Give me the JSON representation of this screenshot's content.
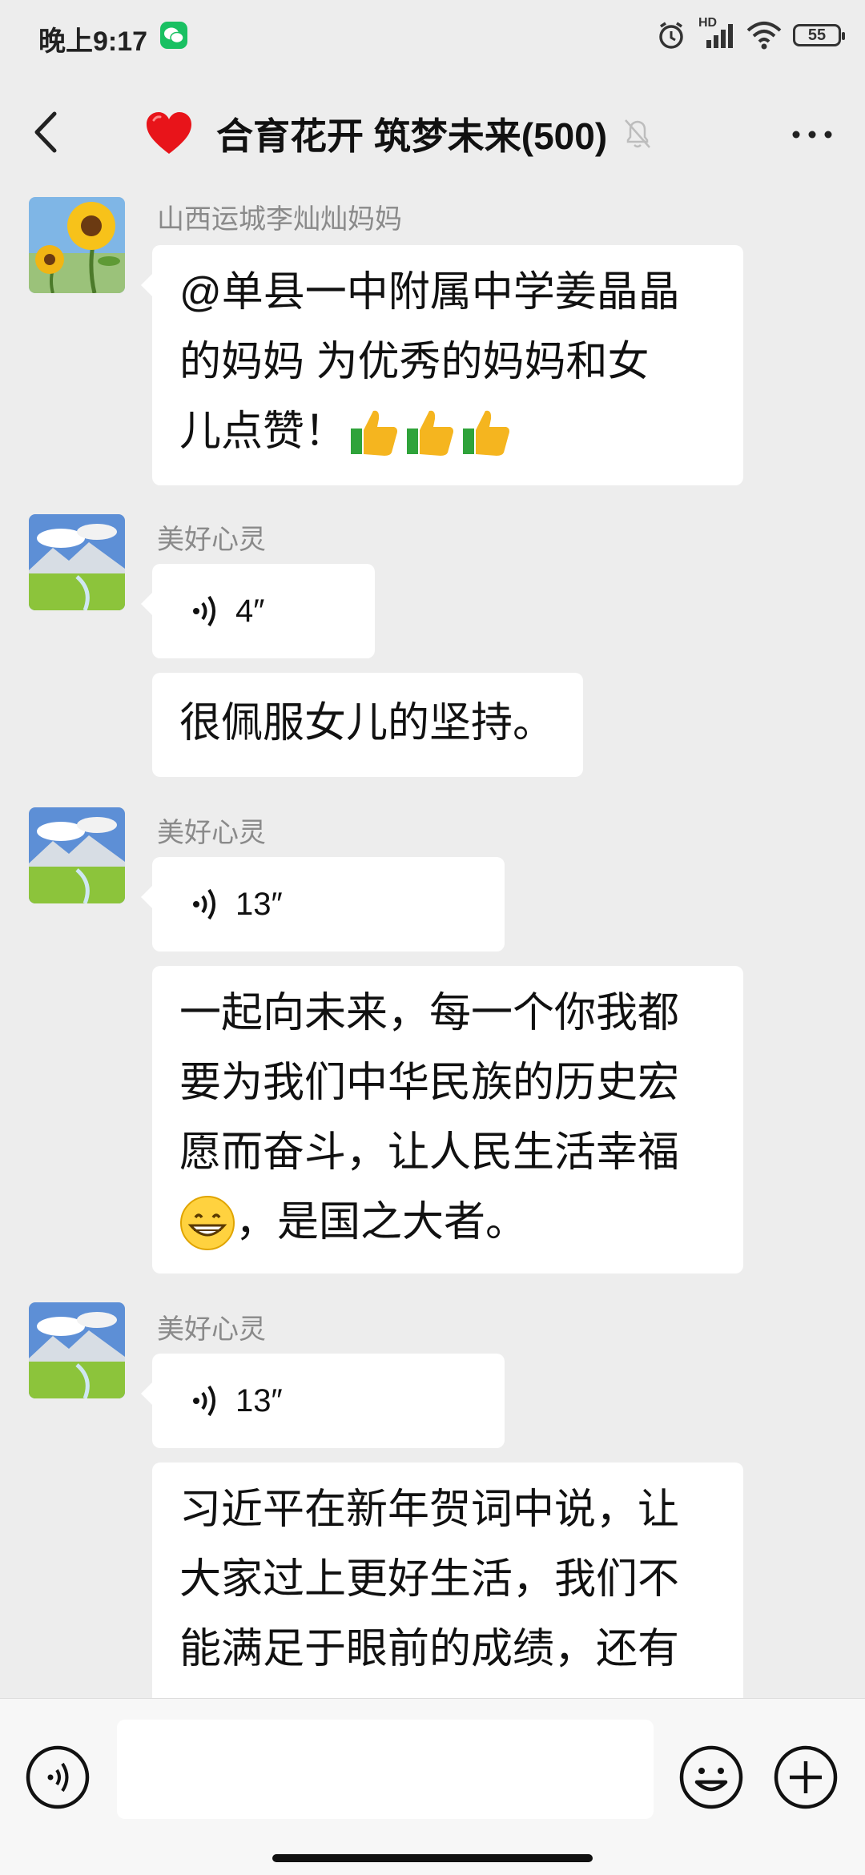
{
  "status_bar": {
    "time": "晚上9:17",
    "network": "HD",
    "battery": "55",
    "icons": [
      "wechat-icon",
      "alarm-icon",
      "signal-icon",
      "wifi-icon",
      "battery-icon"
    ]
  },
  "header": {
    "title": "合育花开 筑梦未来(500)",
    "icons": [
      "back-arrow-icon",
      "red-heart-icon",
      "mute-bell-icon",
      "more-icon"
    ]
  },
  "messages": [
    {
      "sender": "山西运城李灿灿妈妈",
      "avatar": "sunflower-avatar",
      "lines": [
        "@单县一中附属中学姜晶晶",
        "的妈妈  为优秀的妈妈和女",
        "儿点赞！"
      ],
      "emoji": "thumbs-up-icon"
    },
    {
      "sender": "美好心灵",
      "avatar": "landscape-avatar",
      "voice_duration": "4″"
    },
    {
      "text": "很佩服女儿的坚持。"
    },
    {
      "sender": "美好心灵",
      "avatar": "landscape-avatar",
      "voice_duration": "13″"
    },
    {
      "lines": [
        "一起向未来，每一个你我都",
        "要为我们中华民族的历史宏",
        "愿而奋斗，让人民生活幸福",
        "，是国之大者。"
      ],
      "emoji": "grinning-face-icon"
    },
    {
      "sender": "美好心灵",
      "avatar": "landscape-avatar",
      "voice_duration": "13″"
    },
    {
      "lines": [
        "习近平在新年贺词中说，让",
        "大家过上更好生活，我们不",
        "能满足于眼前的成绩，还有"
      ]
    }
  ],
  "input_bar": {
    "text": "",
    "icons": [
      "voice-input-icon",
      "emoji-icon",
      "plus-icon"
    ]
  },
  "colors": {
    "background": "#ededed",
    "bubble": "#ffffff",
    "sender_name": "#8a8a8a",
    "wechat_green": "#19c062"
  }
}
